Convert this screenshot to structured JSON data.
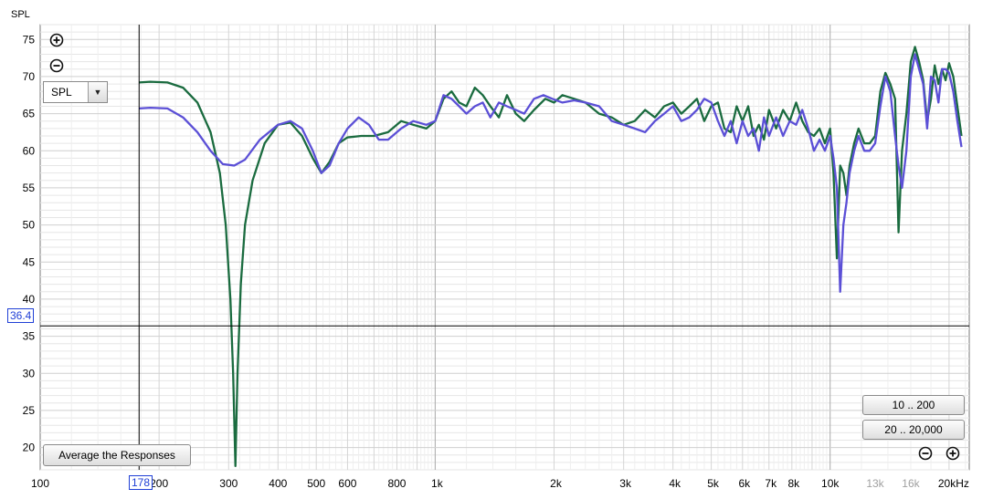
{
  "app": {
    "y_axis_title": "SPL"
  },
  "controls": {
    "spl_select_value": "SPL",
    "average_button_label": "Average the Responses",
    "range_buttons": [
      "10 .. 200",
      "20 .. 20,000"
    ]
  },
  "icons": {
    "zoom_in": "zoom-in-icon",
    "zoom_out": "zoom-out-icon",
    "dropdown_arrow": "chevron-down-icon"
  },
  "cursor": {
    "x_readout": "178",
    "y_readout": "36.4"
  },
  "colors": {
    "series_green": "#1a6b3f",
    "series_blue": "#5b4fd6",
    "cursor": "#1f3fd6"
  },
  "chart_data": {
    "type": "line",
    "title": "",
    "ylabel": "SPL",
    "xlabel": "",
    "x_scale": "log",
    "xlim": [
      100,
      22500
    ],
    "ylim": [
      17,
      77
    ],
    "grid": true,
    "x_ticks": [
      {
        "v": 100,
        "label": "100"
      },
      {
        "v": 200,
        "label": "200"
      },
      {
        "v": 300,
        "label": "300"
      },
      {
        "v": 400,
        "label": "400"
      },
      {
        "v": 500,
        "label": "500"
      },
      {
        "v": 600,
        "label": "600"
      },
      {
        "v": 800,
        "label": "800"
      },
      {
        "v": 1000,
        "label": "1k"
      },
      {
        "v": 2000,
        "label": "2k"
      },
      {
        "v": 3000,
        "label": "3k"
      },
      {
        "v": 4000,
        "label": "4k"
      },
      {
        "v": 5000,
        "label": "5k"
      },
      {
        "v": 6000,
        "label": "6k"
      },
      {
        "v": 7000,
        "label": "7k"
      },
      {
        "v": 8000,
        "label": "8k"
      },
      {
        "v": 10000,
        "label": "10k"
      },
      {
        "v": 13000,
        "label": "13k",
        "faded": true
      },
      {
        "v": 16000,
        "label": "16k",
        "faded": true
      },
      {
        "v": 20000,
        "label": "20kHz"
      }
    ],
    "y_ticks": [
      {
        "v": 75,
        "label": "75"
      },
      {
        "v": 70,
        "label": "70"
      },
      {
        "v": 65,
        "label": "65"
      },
      {
        "v": 60,
        "label": "60"
      },
      {
        "v": 55,
        "label": "55"
      },
      {
        "v": 50,
        "label": "50"
      },
      {
        "v": 45,
        "label": "45"
      },
      {
        "v": 40,
        "label": "40"
      },
      {
        "v": 35,
        "label": "35"
      },
      {
        "v": 30,
        "label": "30"
      },
      {
        "v": 25,
        "label": "25"
      },
      {
        "v": 20,
        "label": "20"
      }
    ],
    "cursor": {
      "x": 178,
      "y": 36.4
    },
    "series": [
      {
        "color": "#1a6b3f",
        "points": [
          [
            178,
            69.2
          ],
          [
            190,
            69.3
          ],
          [
            210,
            69.2
          ],
          [
            230,
            68.5
          ],
          [
            250,
            66.5
          ],
          [
            270,
            62.5
          ],
          [
            285,
            57
          ],
          [
            295,
            50
          ],
          [
            303,
            40
          ],
          [
            308,
            30
          ],
          [
            312,
            17.5
          ],
          [
            316,
            30
          ],
          [
            322,
            42
          ],
          [
            330,
            50
          ],
          [
            345,
            56
          ],
          [
            370,
            61
          ],
          [
            400,
            63.5
          ],
          [
            430,
            63.8
          ],
          [
            460,
            62
          ],
          [
            490,
            59
          ],
          [
            515,
            57
          ],
          [
            540,
            58.5
          ],
          [
            570,
            61
          ],
          [
            600,
            61.8
          ],
          [
            650,
            62
          ],
          [
            700,
            62
          ],
          [
            760,
            62.5
          ],
          [
            820,
            64
          ],
          [
            880,
            63.5
          ],
          [
            950,
            63
          ],
          [
            1000,
            64
          ],
          [
            1050,
            67
          ],
          [
            1100,
            68
          ],
          [
            1150,
            66.5
          ],
          [
            1200,
            66
          ],
          [
            1260,
            68.5
          ],
          [
            1320,
            67.5
          ],
          [
            1380,
            66
          ],
          [
            1450,
            64.5
          ],
          [
            1520,
            67.5
          ],
          [
            1600,
            65
          ],
          [
            1680,
            64
          ],
          [
            1780,
            65.5
          ],
          [
            1900,
            67
          ],
          [
            2000,
            66.5
          ],
          [
            2100,
            67.5
          ],
          [
            2250,
            67
          ],
          [
            2400,
            66.5
          ],
          [
            2600,
            65
          ],
          [
            2800,
            64.5
          ],
          [
            3000,
            63.5
          ],
          [
            3200,
            64
          ],
          [
            3400,
            65.5
          ],
          [
            3600,
            64.5
          ],
          [
            3800,
            66
          ],
          [
            4000,
            66.5
          ],
          [
            4200,
            65
          ],
          [
            4400,
            66
          ],
          [
            4600,
            67
          ],
          [
            4800,
            64
          ],
          [
            5000,
            66
          ],
          [
            5200,
            66.5
          ],
          [
            5400,
            63
          ],
          [
            5600,
            62.5
          ],
          [
            5800,
            66
          ],
          [
            6000,
            64
          ],
          [
            6200,
            66
          ],
          [
            6400,
            62
          ],
          [
            6600,
            63.5
          ],
          [
            6800,
            61.5
          ],
          [
            7000,
            65.5
          ],
          [
            7300,
            63
          ],
          [
            7600,
            65.5
          ],
          [
            7900,
            64
          ],
          [
            8200,
            66.5
          ],
          [
            8500,
            64
          ],
          [
            8800,
            62.5
          ],
          [
            9100,
            62
          ],
          [
            9400,
            63
          ],
          [
            9700,
            61
          ],
          [
            10000,
            63
          ],
          [
            10200,
            57
          ],
          [
            10400,
            45.5
          ],
          [
            10600,
            58
          ],
          [
            10800,
            57
          ],
          [
            11000,
            54
          ],
          [
            11200,
            58
          ],
          [
            11500,
            61
          ],
          [
            11800,
            63
          ],
          [
            12200,
            61
          ],
          [
            12600,
            61
          ],
          [
            13000,
            62
          ],
          [
            13400,
            68
          ],
          [
            13800,
            70.5
          ],
          [
            14200,
            69
          ],
          [
            14600,
            67
          ],
          [
            14900,
            49
          ],
          [
            15200,
            60
          ],
          [
            15600,
            65
          ],
          [
            16000,
            72
          ],
          [
            16400,
            74
          ],
          [
            16800,
            72
          ],
          [
            17200,
            69.5
          ],
          [
            17600,
            64
          ],
          [
            18000,
            67
          ],
          [
            18400,
            71.5
          ],
          [
            18800,
            69
          ],
          [
            19200,
            71
          ],
          [
            19600,
            69.5
          ],
          [
            20000,
            71.8
          ],
          [
            20500,
            70
          ],
          [
            21000,
            66
          ],
          [
            21500,
            62
          ]
        ]
      },
      {
        "color": "#5b4fd6",
        "points": [
          [
            178,
            65.7
          ],
          [
            190,
            65.8
          ],
          [
            210,
            65.7
          ],
          [
            230,
            64.5
          ],
          [
            250,
            62.5
          ],
          [
            270,
            60
          ],
          [
            290,
            58.2
          ],
          [
            310,
            58
          ],
          [
            330,
            58.8
          ],
          [
            360,
            61.5
          ],
          [
            400,
            63.5
          ],
          [
            430,
            64
          ],
          [
            460,
            63
          ],
          [
            490,
            60
          ],
          [
            515,
            57
          ],
          [
            540,
            58
          ],
          [
            570,
            61
          ],
          [
            600,
            63
          ],
          [
            640,
            64.5
          ],
          [
            680,
            63.5
          ],
          [
            720,
            61.5
          ],
          [
            760,
            61.5
          ],
          [
            820,
            63
          ],
          [
            880,
            64
          ],
          [
            950,
            63.5
          ],
          [
            1000,
            64
          ],
          [
            1050,
            67.5
          ],
          [
            1100,
            67
          ],
          [
            1150,
            66
          ],
          [
            1200,
            65
          ],
          [
            1260,
            66
          ],
          [
            1320,
            66.5
          ],
          [
            1380,
            64.5
          ],
          [
            1450,
            66.5
          ],
          [
            1520,
            66
          ],
          [
            1600,
            65.5
          ],
          [
            1680,
            65
          ],
          [
            1780,
            67
          ],
          [
            1880,
            67.5
          ],
          [
            1980,
            67
          ],
          [
            2100,
            66.5
          ],
          [
            2250,
            66.8
          ],
          [
            2400,
            66.5
          ],
          [
            2600,
            66
          ],
          [
            2800,
            64
          ],
          [
            3000,
            63.5
          ],
          [
            3200,
            63
          ],
          [
            3400,
            62.5
          ],
          [
            3600,
            64
          ],
          [
            3800,
            65
          ],
          [
            4000,
            66
          ],
          [
            4200,
            64
          ],
          [
            4400,
            64.5
          ],
          [
            4600,
            65.5
          ],
          [
            4800,
            67
          ],
          [
            5000,
            66.5
          ],
          [
            5200,
            64
          ],
          [
            5400,
            62
          ],
          [
            5600,
            64
          ],
          [
            5800,
            61
          ],
          [
            6000,
            64
          ],
          [
            6200,
            62
          ],
          [
            6400,
            63
          ],
          [
            6600,
            60
          ],
          [
            6800,
            64.5
          ],
          [
            7000,
            62
          ],
          [
            7300,
            64.5
          ],
          [
            7600,
            62
          ],
          [
            7900,
            64
          ],
          [
            8200,
            63.5
          ],
          [
            8500,
            65.5
          ],
          [
            8800,
            63
          ],
          [
            9100,
            60
          ],
          [
            9400,
            61.5
          ],
          [
            9700,
            60
          ],
          [
            10000,
            62
          ],
          [
            10200,
            59
          ],
          [
            10400,
            55
          ],
          [
            10600,
            41
          ],
          [
            10800,
            50
          ],
          [
            11000,
            53
          ],
          [
            11200,
            57
          ],
          [
            11500,
            60
          ],
          [
            11800,
            62
          ],
          [
            12200,
            60
          ],
          [
            12600,
            60
          ],
          [
            13000,
            61
          ],
          [
            13400,
            66
          ],
          [
            13800,
            70
          ],
          [
            14200,
            68
          ],
          [
            14600,
            62
          ],
          [
            14900,
            58
          ],
          [
            15200,
            55
          ],
          [
            15600,
            60
          ],
          [
            16000,
            70
          ],
          [
            16400,
            73
          ],
          [
            16800,
            71
          ],
          [
            17200,
            69
          ],
          [
            17600,
            63
          ],
          [
            18000,
            70
          ],
          [
            18400,
            69.5
          ],
          [
            18800,
            66.5
          ],
          [
            19200,
            71
          ],
          [
            19600,
            71
          ],
          [
            20000,
            70.5
          ],
          [
            20500,
            68
          ],
          [
            21000,
            64
          ],
          [
            21500,
            60.5
          ]
        ]
      }
    ]
  }
}
